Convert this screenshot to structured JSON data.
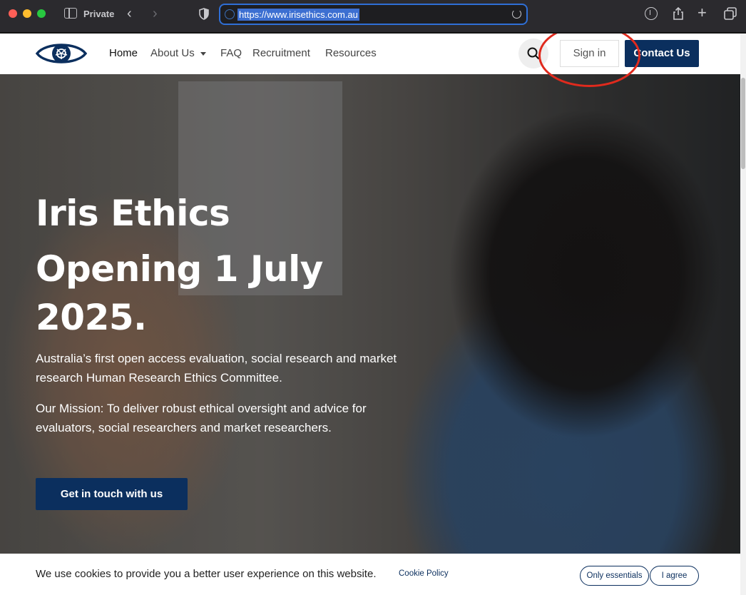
{
  "browser": {
    "private_label": "Private",
    "url": "https://www.irisethics.com.au"
  },
  "nav": {
    "items": [
      "Home",
      "About Us",
      "FAQ",
      "Recruitment",
      "Resources"
    ],
    "sign_in": "Sign in",
    "contact": "Contact Us"
  },
  "hero": {
    "title_lines": [
      "Iris Ethics",
      "Opening 1 July",
      "2025."
    ],
    "description": "Australia’s first open access evaluation, social research and market research Human Research Ethics Committee.",
    "mission": "Our Mission: To deliver robust ethical oversight and advice for evaluators, social researchers and market researchers.",
    "cta": "Get in touch with us"
  },
  "cookie": {
    "message": "We use cookies to provide you a better user experience on this website.",
    "policy_link": "Cookie Policy",
    "essentials_button": "Only essentials",
    "agree_button": "I agree"
  },
  "colors": {
    "brand_navy": "#0b2f5e",
    "highlight_red": "#e02a1d",
    "url_focus": "#2f6fd6"
  }
}
